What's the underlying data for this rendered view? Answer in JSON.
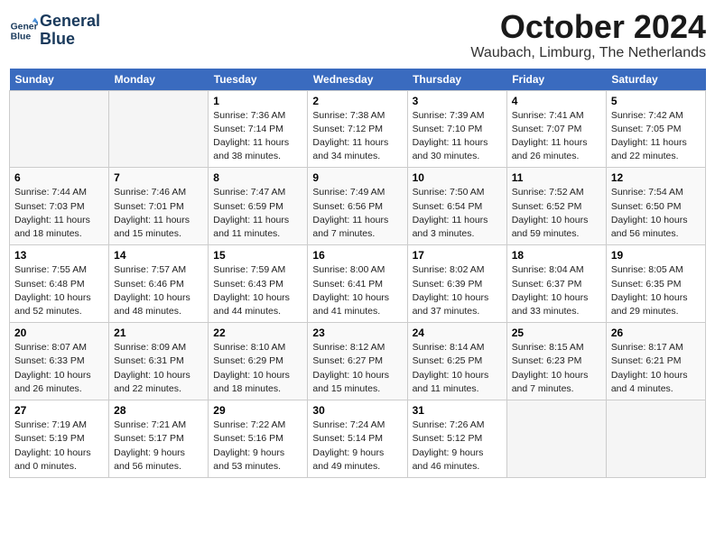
{
  "logo": {
    "line1": "General",
    "line2": "Blue"
  },
  "title": "October 2024",
  "location": "Waubach, Limburg, The Netherlands",
  "weekdays": [
    "Sunday",
    "Monday",
    "Tuesday",
    "Wednesday",
    "Thursday",
    "Friday",
    "Saturday"
  ],
  "weeks": [
    [
      {
        "day": "",
        "info": ""
      },
      {
        "day": "",
        "info": ""
      },
      {
        "day": "1",
        "info": "Sunrise: 7:36 AM\nSunset: 7:14 PM\nDaylight: 11 hours and 38 minutes."
      },
      {
        "day": "2",
        "info": "Sunrise: 7:38 AM\nSunset: 7:12 PM\nDaylight: 11 hours and 34 minutes."
      },
      {
        "day": "3",
        "info": "Sunrise: 7:39 AM\nSunset: 7:10 PM\nDaylight: 11 hours and 30 minutes."
      },
      {
        "day": "4",
        "info": "Sunrise: 7:41 AM\nSunset: 7:07 PM\nDaylight: 11 hours and 26 minutes."
      },
      {
        "day": "5",
        "info": "Sunrise: 7:42 AM\nSunset: 7:05 PM\nDaylight: 11 hours and 22 minutes."
      }
    ],
    [
      {
        "day": "6",
        "info": "Sunrise: 7:44 AM\nSunset: 7:03 PM\nDaylight: 11 hours and 18 minutes."
      },
      {
        "day": "7",
        "info": "Sunrise: 7:46 AM\nSunset: 7:01 PM\nDaylight: 11 hours and 15 minutes."
      },
      {
        "day": "8",
        "info": "Sunrise: 7:47 AM\nSunset: 6:59 PM\nDaylight: 11 hours and 11 minutes."
      },
      {
        "day": "9",
        "info": "Sunrise: 7:49 AM\nSunset: 6:56 PM\nDaylight: 11 hours and 7 minutes."
      },
      {
        "day": "10",
        "info": "Sunrise: 7:50 AM\nSunset: 6:54 PM\nDaylight: 11 hours and 3 minutes."
      },
      {
        "day": "11",
        "info": "Sunrise: 7:52 AM\nSunset: 6:52 PM\nDaylight: 10 hours and 59 minutes."
      },
      {
        "day": "12",
        "info": "Sunrise: 7:54 AM\nSunset: 6:50 PM\nDaylight: 10 hours and 56 minutes."
      }
    ],
    [
      {
        "day": "13",
        "info": "Sunrise: 7:55 AM\nSunset: 6:48 PM\nDaylight: 10 hours and 52 minutes."
      },
      {
        "day": "14",
        "info": "Sunrise: 7:57 AM\nSunset: 6:46 PM\nDaylight: 10 hours and 48 minutes."
      },
      {
        "day": "15",
        "info": "Sunrise: 7:59 AM\nSunset: 6:43 PM\nDaylight: 10 hours and 44 minutes."
      },
      {
        "day": "16",
        "info": "Sunrise: 8:00 AM\nSunset: 6:41 PM\nDaylight: 10 hours and 41 minutes."
      },
      {
        "day": "17",
        "info": "Sunrise: 8:02 AM\nSunset: 6:39 PM\nDaylight: 10 hours and 37 minutes."
      },
      {
        "day": "18",
        "info": "Sunrise: 8:04 AM\nSunset: 6:37 PM\nDaylight: 10 hours and 33 minutes."
      },
      {
        "day": "19",
        "info": "Sunrise: 8:05 AM\nSunset: 6:35 PM\nDaylight: 10 hours and 29 minutes."
      }
    ],
    [
      {
        "day": "20",
        "info": "Sunrise: 8:07 AM\nSunset: 6:33 PM\nDaylight: 10 hours and 26 minutes."
      },
      {
        "day": "21",
        "info": "Sunrise: 8:09 AM\nSunset: 6:31 PM\nDaylight: 10 hours and 22 minutes."
      },
      {
        "day": "22",
        "info": "Sunrise: 8:10 AM\nSunset: 6:29 PM\nDaylight: 10 hours and 18 minutes."
      },
      {
        "day": "23",
        "info": "Sunrise: 8:12 AM\nSunset: 6:27 PM\nDaylight: 10 hours and 15 minutes."
      },
      {
        "day": "24",
        "info": "Sunrise: 8:14 AM\nSunset: 6:25 PM\nDaylight: 10 hours and 11 minutes."
      },
      {
        "day": "25",
        "info": "Sunrise: 8:15 AM\nSunset: 6:23 PM\nDaylight: 10 hours and 7 minutes."
      },
      {
        "day": "26",
        "info": "Sunrise: 8:17 AM\nSunset: 6:21 PM\nDaylight: 10 hours and 4 minutes."
      }
    ],
    [
      {
        "day": "27",
        "info": "Sunrise: 7:19 AM\nSunset: 5:19 PM\nDaylight: 10 hours and 0 minutes."
      },
      {
        "day": "28",
        "info": "Sunrise: 7:21 AM\nSunset: 5:17 PM\nDaylight: 9 hours and 56 minutes."
      },
      {
        "day": "29",
        "info": "Sunrise: 7:22 AM\nSunset: 5:16 PM\nDaylight: 9 hours and 53 minutes."
      },
      {
        "day": "30",
        "info": "Sunrise: 7:24 AM\nSunset: 5:14 PM\nDaylight: 9 hours and 49 minutes."
      },
      {
        "day": "31",
        "info": "Sunrise: 7:26 AM\nSunset: 5:12 PM\nDaylight: 9 hours and 46 minutes."
      },
      {
        "day": "",
        "info": ""
      },
      {
        "day": "",
        "info": ""
      }
    ]
  ]
}
